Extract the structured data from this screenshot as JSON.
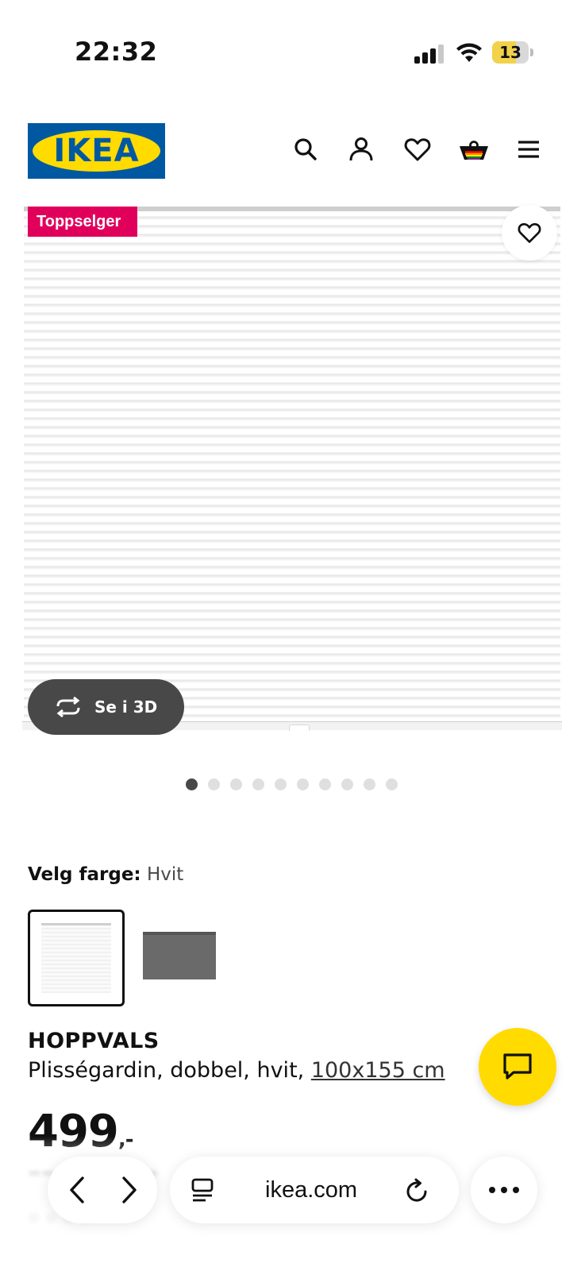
{
  "status_bar": {
    "time": "22:32",
    "battery": "13",
    "battery_color": "#f2d24a"
  },
  "header": {
    "logo_text": "IKEA",
    "logo_colors": {
      "blue": "#0058a3",
      "yellow": "#ffdb00"
    },
    "icons": [
      "search-icon",
      "profile-icon",
      "favourites-icon",
      "shopping-bag-icon",
      "menu-icon"
    ]
  },
  "product_image": {
    "badge": "Toppselger",
    "badge_color": "#e0005c",
    "view_3d_label": "Se i 3D",
    "carousel": {
      "count": 10,
      "active_index": 0
    }
  },
  "color_picker": {
    "label": "Velg farge:",
    "selected_value": "Hvit",
    "options": [
      "white",
      "grey"
    ]
  },
  "product": {
    "name": "HOPPVALS",
    "description": "Plisségardin, dobbel, hvit, ",
    "size_link": "100x155 cm",
    "price": "499",
    "price_suffix": ",-"
  },
  "browser": {
    "url": "ikea.com"
  }
}
